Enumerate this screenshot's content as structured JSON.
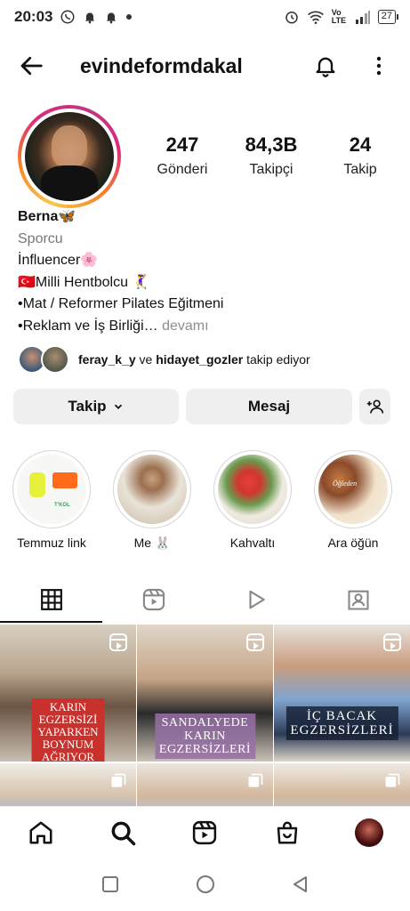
{
  "status_bar": {
    "time": "20:03",
    "left_icons": [
      "whatsapp-icon",
      "notification-bell-icon",
      "notification-bell-icon",
      "dot-icon"
    ],
    "right_icons": [
      "alarm-icon",
      "wifi-icon",
      "volte-icon",
      "signal-icon"
    ],
    "volte_label": "Vo LTE",
    "battery": "27"
  },
  "header": {
    "username": "evindeformdakal",
    "icons": [
      "back-arrow-icon",
      "bell-icon",
      "more-vertical-icon"
    ]
  },
  "profile": {
    "stats": [
      {
        "value": "247",
        "label": "Gönderi"
      },
      {
        "value": "84,3B",
        "label": "Takipçi"
      },
      {
        "value": "24",
        "label": "Takip"
      }
    ],
    "name": "Berna🦋",
    "category": "Sporcu",
    "bio_lines": [
      "İnfluencer🌸",
      "🇹🇷Milli Hentbolcu 🤾‍♀️",
      "•Mat / Reformer Pilates Eğitmeni",
      "•Reklam ve İş Birliği…"
    ],
    "more_link": "devamı",
    "followed_by": {
      "user1": "feray_k_y",
      "connector": "ve",
      "user2": "hidayet_gozler",
      "suffix": "takip ediyor"
    }
  },
  "buttons": {
    "follow": "Takip",
    "message": "Mesaj",
    "add_person_icon": "add-person-icon"
  },
  "highlights": [
    {
      "label": "Temmuz link",
      "tag": "T'KOL"
    },
    {
      "label": "Me 🐰"
    },
    {
      "label": "Kahvaltı"
    },
    {
      "label": "Ara öğün",
      "overlay": "Öğleden"
    }
  ],
  "tabs": [
    "grid-icon",
    "reels-icon",
    "play-icon",
    "tagged-icon"
  ],
  "posts": [
    {
      "caption": "KARIN EGZERSİZİ\nYAPARKEN BOYNUM\nAĞRIYOR DİYENLERE",
      "type": "reel"
    },
    {
      "caption": "SANDALYEDE\nKARIN\nEGZERSİZLERİ",
      "type": "reel"
    },
    {
      "caption": "İÇ BACAK\nEGZERSİZLERİ",
      "type": "reel"
    },
    {
      "caption": "",
      "type": "carousel"
    },
    {
      "caption": "",
      "type": "carousel"
    },
    {
      "caption": "",
      "type": "carousel"
    }
  ],
  "bottom_nav": [
    "home-icon",
    "search-icon",
    "reels-icon",
    "shop-icon",
    "profile-avatar"
  ],
  "system_nav": [
    "recents-icon",
    "home-circle-icon",
    "back-triangle-icon"
  ]
}
